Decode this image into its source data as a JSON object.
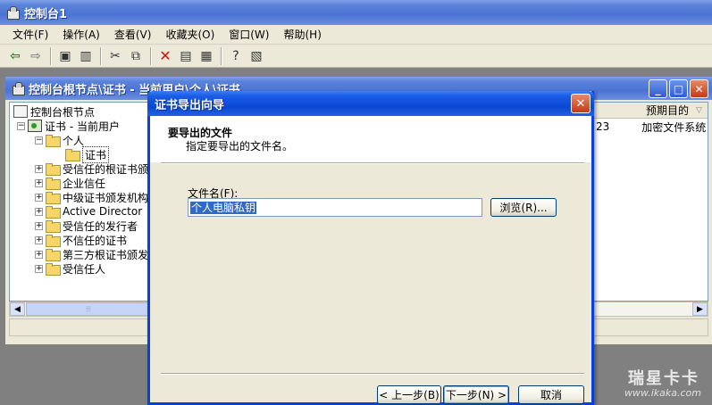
{
  "app": {
    "title": "控制台1"
  },
  "menu": [
    "文件(F)",
    "操作(A)",
    "查看(V)",
    "收藏夹(O)",
    "窗口(W)",
    "帮助(H)"
  ],
  "child": {
    "title": "控制台根节点\\证书 - 当前用户\\个人\\证书"
  },
  "tree": {
    "items": [
      "控制台根节点",
      "证书 - 当前用户",
      "个人",
      "证书",
      "受信任的根证书颁",
      "企业信任",
      "中级证书颁发机构",
      "Active Director",
      "受信任的发行者",
      "不信任的证书",
      "第三方根证书颁发",
      "受信任人"
    ]
  },
  "list": {
    "col_purpose": "预期目的",
    "row_fragment": "23",
    "row_purpose": "加密文件系统"
  },
  "dialog": {
    "title": "证书导出向导",
    "heading": "要导出的文件",
    "subheading": "指定要导出的文件名。",
    "file_label": "文件名(F):",
    "file_value": "个人电脑私钥",
    "browse": "浏览(R)...",
    "back": "< 上一步(B)",
    "next": "下一步(N) >",
    "cancel": "取消"
  },
  "watermark": {
    "logo": "瑞星卡卡",
    "url": "www.ikaka.com"
  }
}
